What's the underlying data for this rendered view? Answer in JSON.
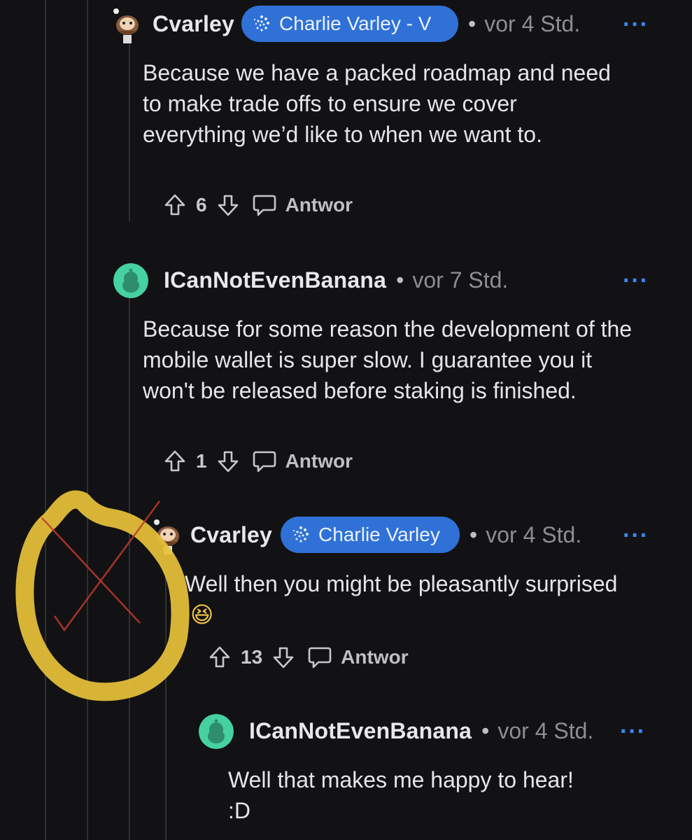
{
  "comments": [
    {
      "username": "Cvarley",
      "flair": "Charlie Varley - V",
      "time": "vor 4 Std.",
      "text": "Because we have a packed roadmap and need to make trade offs to ensure we cover everything we’d like to when we want to.",
      "upvotes": "6",
      "reply_label": "Antwor",
      "avatar": "cvarley-avatar"
    },
    {
      "username": "ICanNotEvenBanana",
      "time": "vor 7 Std.",
      "text": "Because for some reason the development of the mobile wallet is super slow. I guarantee you it won't be released before staking is finished.",
      "upvotes": "1",
      "reply_label": "Antwor",
      "avatar": "snoo-avatar"
    },
    {
      "username": "Cvarley",
      "flair": "Charlie Varley",
      "time": "vor 4 Std.",
      "text": "Well then you might be pleasantly surprised",
      "emoji": "😆",
      "upvotes": "13",
      "reply_label": "Antwor",
      "avatar": "cvarley-avatar"
    },
    {
      "username": "ICanNotEvenBanana",
      "time": "vor 4 Std.",
      "text_line1": "Well that makes me happy to hear!",
      "text_line2": ":D",
      "avatar": "snoo-avatar"
    }
  ],
  "dot": "•",
  "more": "···",
  "colors": {
    "background": "#121214",
    "flair": "#2f71d6",
    "more": "#3a86f5",
    "highlight_circle": "#e8c23a",
    "cross": "#c0392b"
  }
}
